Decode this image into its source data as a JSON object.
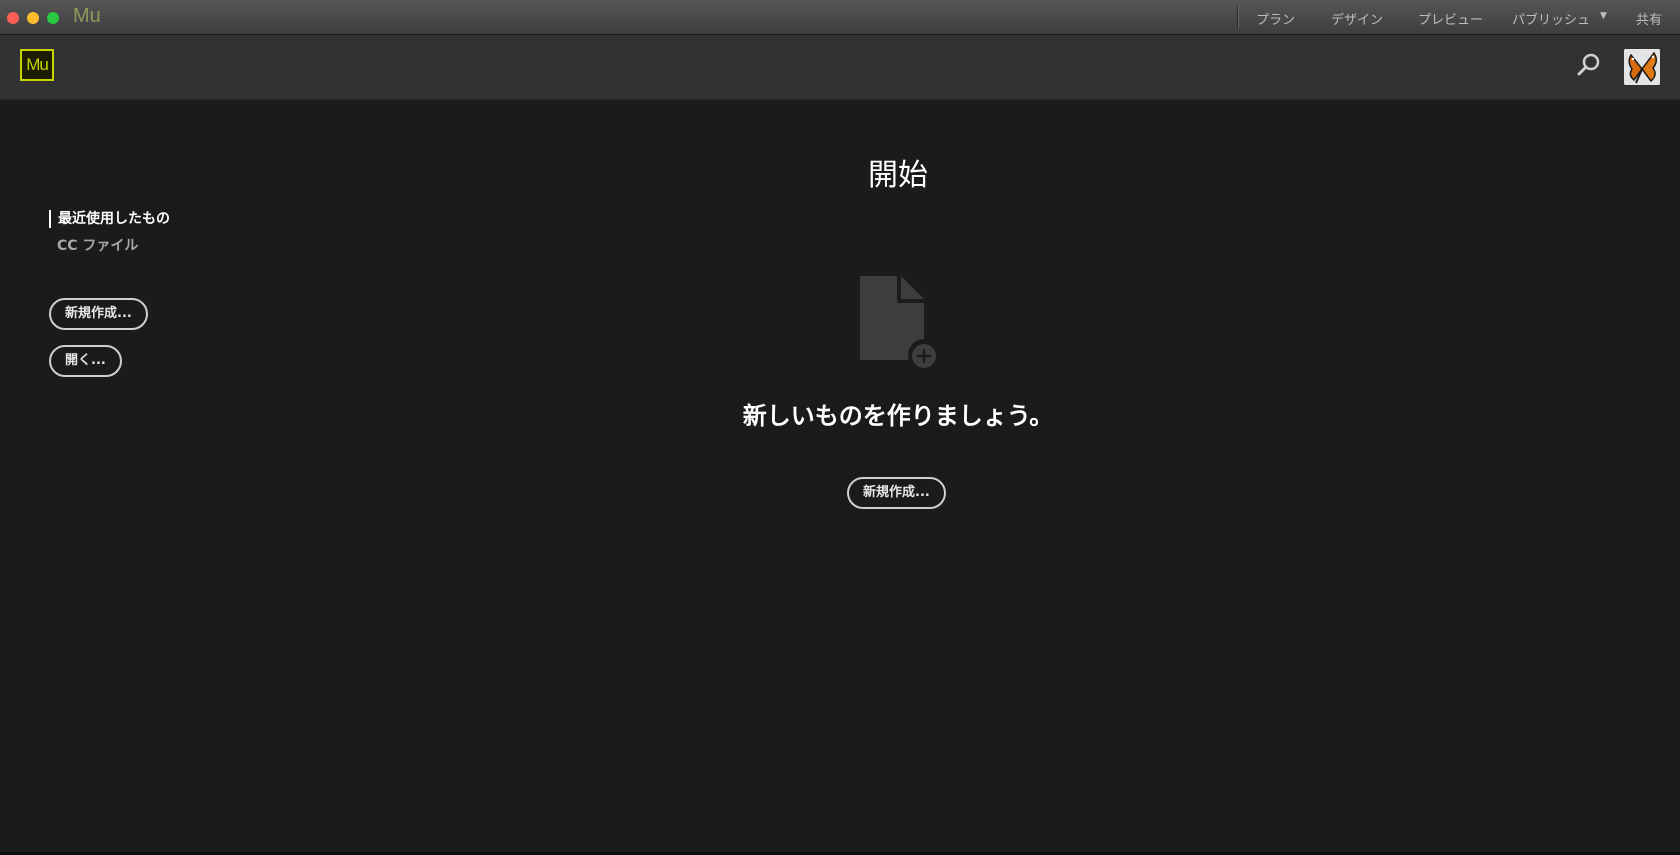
{
  "window": {
    "app_title": "Mu",
    "menu": {
      "plan": "プラン",
      "design": "デザイン",
      "preview": "プレビュー",
      "publish": "パブリッシュ",
      "share": "共有"
    }
  },
  "header": {
    "logo_text": "Mu",
    "logo_color": "#c7d400",
    "search_icon": "search-icon",
    "avatar_icon": "butterfly-avatar"
  },
  "sidebar": {
    "recent_label": "最近使用したもの",
    "cc_files_label": "CC ファイル",
    "new_button": "新規作成...",
    "open_button": "開く..."
  },
  "main": {
    "title": "開始",
    "icon": "new-document-icon",
    "headline": "新しいものを作りましょう。",
    "new_button": "新規作成..."
  }
}
